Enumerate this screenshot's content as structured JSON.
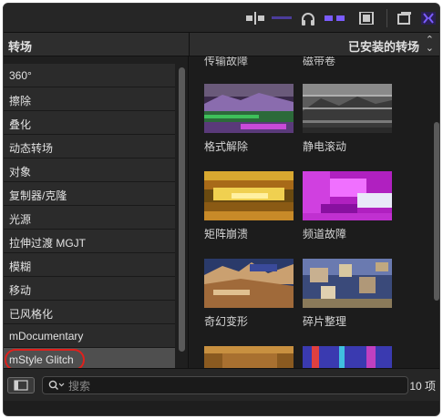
{
  "header": {
    "left_title": "转场",
    "right_title": "已安装的转场"
  },
  "toolbar": {
    "icons": [
      "split-clip-icon",
      "timeline-icon",
      "headphones-icon",
      "skimming-icon",
      "film-viewer-icon",
      "window-layout-icon",
      "snapping-icon"
    ],
    "accent_color": "#7b5cff"
  },
  "sidebar": {
    "items": [
      {
        "label": "360°"
      },
      {
        "label": "擦除"
      },
      {
        "label": "叠化"
      },
      {
        "label": "动态转场"
      },
      {
        "label": "对象"
      },
      {
        "label": "复制器/克隆"
      },
      {
        "label": "光源"
      },
      {
        "label": "拉伸过渡 MGJT"
      },
      {
        "label": "模糊"
      },
      {
        "label": "移动"
      },
      {
        "label": "已风格化"
      },
      {
        "label": "mDocumentary"
      },
      {
        "label": "mStyle Glitch",
        "selected": true
      }
    ]
  },
  "browser": {
    "partial_labels": [
      "传输故障",
      "磁带卷"
    ],
    "transitions": [
      {
        "label": "格式解除"
      },
      {
        "label": "静电滚动"
      },
      {
        "label": "矩阵崩溃"
      },
      {
        "label": "频道故障"
      },
      {
        "label": "奇幻变形"
      },
      {
        "label": "碎片整理"
      },
      {
        "label": ""
      },
      {
        "label": ""
      }
    ]
  },
  "search": {
    "placeholder": "搜索",
    "value": ""
  },
  "status": {
    "count_label": "10 项"
  }
}
